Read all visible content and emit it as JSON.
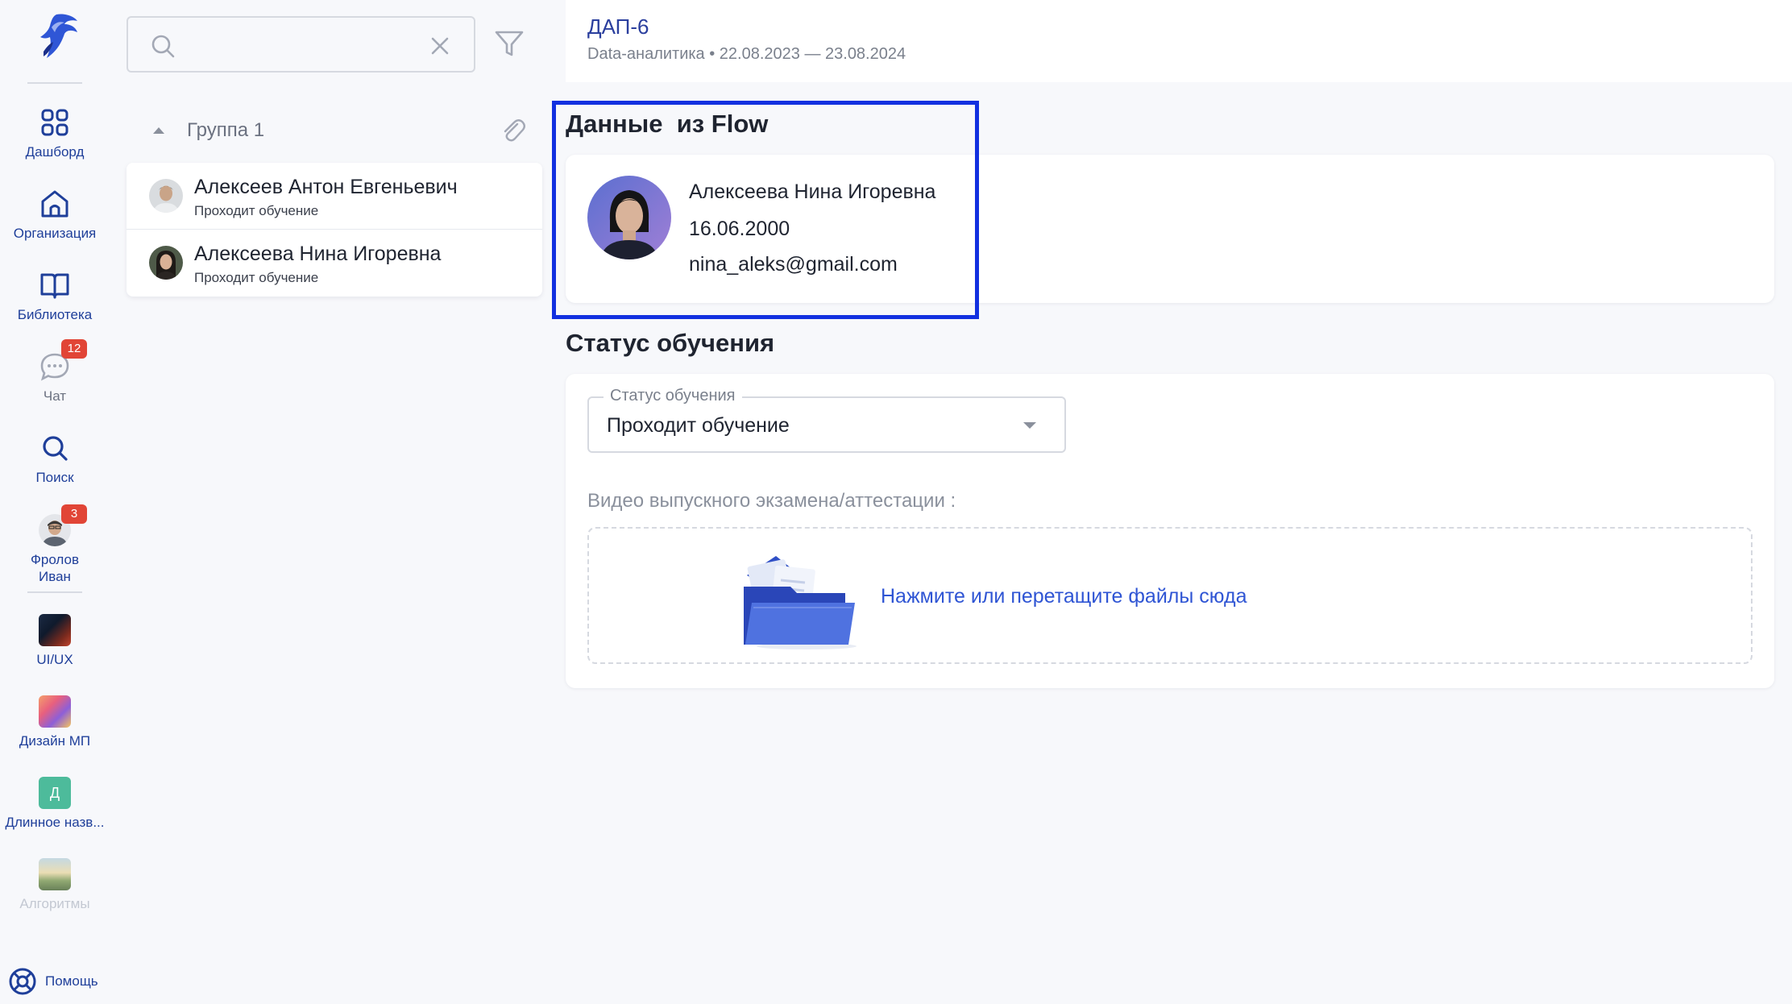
{
  "rail": {
    "items": [
      {
        "label": "Дашборд",
        "icon": "dashboard-icon"
      },
      {
        "label": "Организация",
        "icon": "home-icon"
      },
      {
        "label": "Библиотека",
        "icon": "book-icon"
      },
      {
        "label": "Чат",
        "icon": "chat-icon",
        "badge": "12"
      },
      {
        "label": "Поиск",
        "icon": "search-icon"
      },
      {
        "label_line1": "Фролов",
        "label_line2": "Иван",
        "badge": "3"
      },
      {
        "label": "UI/UX"
      },
      {
        "label": "Дизайн МП"
      },
      {
        "label": "Длинное назв...",
        "avatar_letter": "Д"
      },
      {
        "label": "Алгоритмы"
      }
    ],
    "help_label": "Помощь"
  },
  "search": {
    "value": "",
    "placeholder": ""
  },
  "group": {
    "title": "Группа 1"
  },
  "people": [
    {
      "name": "Алексеев Антон Евгеньевич",
      "status": "Проходит обучение"
    },
    {
      "name": "Алексеева Нина Игоревна",
      "status": "Проходит обучение"
    }
  ],
  "header": {
    "title": "ДАП-6",
    "subtitle": "Data-аналитика • 22.08.2023 — 23.08.2024"
  },
  "flow": {
    "section_title": "Данные  из Flow",
    "name": "Алексеева Нина Игоревна",
    "birth_date": "16.06.2000",
    "email": "nina_aleks@gmail.com"
  },
  "status": {
    "section_title": "Статус обучения",
    "field_label": "Статус обучения",
    "field_value": "Проходит обучение",
    "video_label": "Видео выпускного экзамена/аттестации :",
    "dropzone_text": "Нажмите или перетащите файлы сюда"
  },
  "colors": {
    "accent": "#1f3f9a",
    "link": "#2f55d4",
    "badge": "#e14536",
    "highlight": "#1230e0"
  }
}
